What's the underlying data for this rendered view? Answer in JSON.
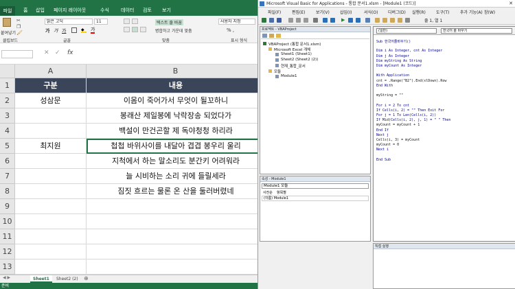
{
  "excel": {
    "ribbon_tabs": [
      "파일",
      "홈",
      "삽입",
      "페이지 레이아웃",
      "수식",
      "데이터",
      "검토",
      "보기"
    ],
    "font_name": "맑은 고딕",
    "font_size": "11",
    "wrap_text_label": "텍스트 줄 바꿈",
    "merge_label": "병합하고 가운데 맞춤",
    "number_format": "사용자 지정",
    "paste_label": "붙여넣기",
    "group_clipboard": "클립보드",
    "group_font": "글꼴",
    "group_align": "맞춤",
    "group_number": "표시 형식",
    "formula_bar": {
      "name_box": "",
      "fx": "fx",
      "value": ""
    },
    "columns": [
      "A",
      "B"
    ],
    "rows": [
      {
        "num": "1",
        "a": "구분",
        "b": "내용"
      },
      {
        "num": "2",
        "a": "성삼문",
        "b": "이몸이 죽어가서 무엇이 될꼬하니"
      },
      {
        "num": "3",
        "a": "",
        "b": "봉래산 제일봉에 낙락장송 되었다가"
      },
      {
        "num": "4",
        "a": "",
        "b": "백설이 만건곤할 제 독야청청 하리라"
      },
      {
        "num": "5",
        "a": "최지원",
        "b": "첩첩 바위사이를 내달아 겹겹 봉우리 울리"
      },
      {
        "num": "6",
        "a": "",
        "b": "지척에서 하는 말소리도 분간키 어려워라"
      },
      {
        "num": "7",
        "a": "",
        "b": "늘 시비하는 소리 귀에 들릴세라"
      },
      {
        "num": "8",
        "a": "",
        "b": "짐짓 흐르는 물론 온 산을 둘러버렸네"
      },
      {
        "num": "9",
        "a": "",
        "b": ""
      },
      {
        "num": "10",
        "a": "",
        "b": ""
      },
      {
        "num": "11",
        "a": "",
        "b": ""
      },
      {
        "num": "12",
        "a": "",
        "b": ""
      },
      {
        "num": "13",
        "a": "",
        "b": ""
      },
      {
        "num": "14",
        "a": "",
        "b": ""
      }
    ],
    "sheet_tabs": [
      "Sheet1",
      "Sheet2 (2)"
    ],
    "status": "준비"
  },
  "vba": {
    "title": "Microsoft Visual Basic for Applications - 통합 문서1.xlsm - [Module1 (코드)]",
    "menus": [
      "파일(F)",
      "편집(E)",
      "보기(V)",
      "삽입(I)",
      "서식(O)",
      "디버그(D)",
      "실행(R)",
      "도구(T)",
      "추가 기능(A)",
      "창(W)"
    ],
    "cursor_pos": "줄 1, 열 1",
    "project_title": "프로젝트 - VBAProject",
    "tree": [
      "VBAProject (통합 문서1.xlsm)",
      "Microsoft Excel 개체",
      "Sheet1 (Sheet1)",
      "Sheet2 (Sheet2 (2))",
      "현재_통합_문서",
      "모듈",
      "Module1"
    ],
    "properties_title": "속성 - Module1",
    "properties_combo": "Module1 모듈",
    "properties_tabs": [
      "사전순",
      "항목별"
    ],
    "properties_row": "(이름) Module1",
    "code_combo_left": "(일반)",
    "code_combo_right": "한국어 줄 바꾸기",
    "code": [
      "Sub 한국어줄바꾸기()",
      "",
      "Dim i As Integer, cnt As Integer",
      "Dim j As Integer",
      "Dim myString As String",
      "Dim myCount As Integer",
      "",
      "With Application",
      "  cnt = .Range(\"B2\").End(xlDown).Row",
      "End With",
      "",
      "myString = \"\"",
      "",
      "For i = 2 To cnt",
      "  If Cells(i, 2) = \"\" Then Exit For",
      "  For j = 1 To Len(Cells(i, 2))",
      "    If Mid(Cells(i, 2), j, 1) = \" \" Then",
      "      myCount = myCount + 1",
      "    End If",
      "  Next j",
      "  Cells(i, 3) = myCount",
      "  myCount = 0",
      "Next i",
      "",
      "End Sub"
    ],
    "immediate_title": "직접 실행"
  }
}
